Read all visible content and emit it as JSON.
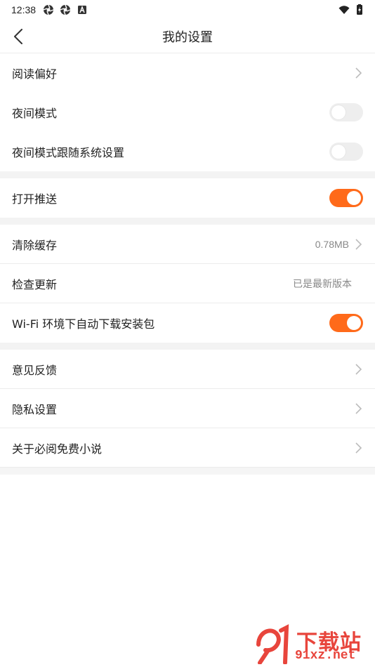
{
  "status_bar": {
    "time": "12:38",
    "left_icons": [
      "aperture-icon",
      "aperture-icon",
      "android-icon"
    ],
    "right_icons": [
      "wifi-icon",
      "battery-icon"
    ]
  },
  "header": {
    "title": "我的设置"
  },
  "sections": [
    {
      "rows": [
        {
          "label": "阅读偏好",
          "type": "link"
        },
        {
          "label": "夜间模式",
          "type": "toggle",
          "on": false
        },
        {
          "label": "夜间模式跟随系统设置",
          "type": "toggle",
          "on": false
        }
      ]
    },
    {
      "rows": [
        {
          "label": "打开推送",
          "type": "toggle",
          "on": true
        }
      ]
    },
    {
      "rows": [
        {
          "label": "清除缓存",
          "type": "link",
          "value": "0.78MB"
        },
        {
          "label": "检查更新",
          "type": "value",
          "value": "已是最新版本"
        },
        {
          "label": "Wi-Fi 环境下自动下载安装包",
          "type": "toggle",
          "on": true
        }
      ]
    },
    {
      "rows": [
        {
          "label": "意见反馈",
          "type": "link"
        },
        {
          "label": "隐私设置",
          "type": "link"
        },
        {
          "label": "关于必阅免费小说",
          "type": "link"
        }
      ]
    }
  ],
  "colors": {
    "accent": "#ff6a1a",
    "toggle_off": "#eeeeee",
    "watermark": "#e8453c"
  },
  "watermark": {
    "title": "下载站",
    "site": "91xz.net"
  }
}
